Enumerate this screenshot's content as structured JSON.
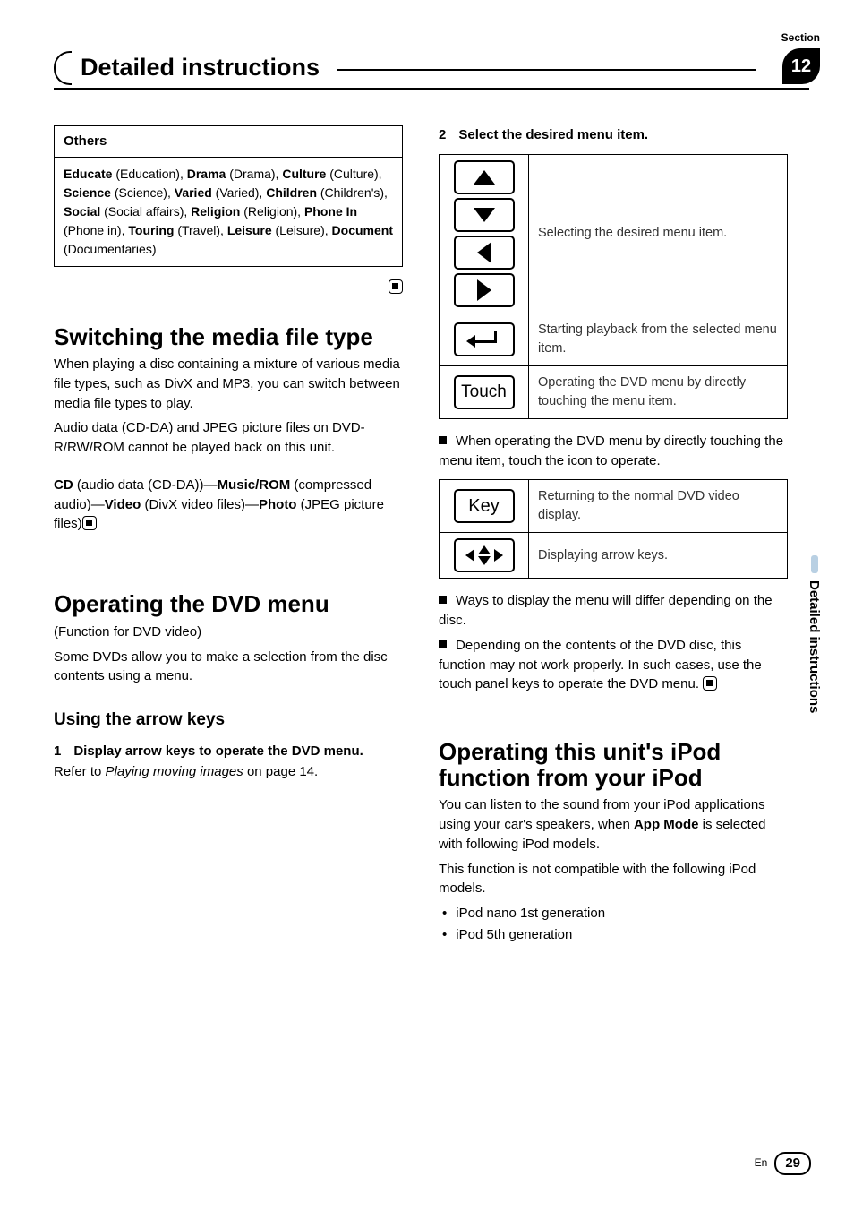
{
  "header": {
    "section_label": "Section",
    "section_number": "12",
    "title": "Detailed instructions"
  },
  "left": {
    "others_box": {
      "header": "Others",
      "body_segments": [
        {
          "b": "Educate",
          "t": " (Education), "
        },
        {
          "b": "Drama",
          "t": " (Drama), "
        },
        {
          "b": "Culture",
          "t": " (Culture), "
        },
        {
          "b": "Science",
          "t": " (Science), "
        },
        {
          "b": "Varied",
          "t": " (Varied), "
        },
        {
          "b": "Children",
          "t": " (Children's), "
        },
        {
          "b": "Social",
          "t": " (Social affairs), "
        },
        {
          "b": "Religion",
          "t": " (Religion), "
        },
        {
          "b": "Phone In",
          "t": " (Phone in), "
        },
        {
          "b": "Touring",
          "t": " (Travel), "
        },
        {
          "b": "Leisure",
          "t": " (Leisure), "
        },
        {
          "b": "Document",
          "t": " (Documentaries)"
        }
      ]
    },
    "switching_heading": "Switching the media file type",
    "switching_p1": "When playing a disc containing a mixture of various media file types, such as DivX and MP3, you can switch between media file types to play.",
    "switching_p2": "Audio data (CD-DA) and JPEG picture files on DVD-R/RW/ROM cannot be played back on this unit.",
    "switching_chain": [
      {
        "b": "CD",
        "t": " (audio data (CD-DA))—"
      },
      {
        "b": "Music/ROM",
        "t": " (compressed audio)—"
      },
      {
        "b": "Video",
        "t": " (DivX video files)—"
      },
      {
        "b": "Photo",
        "t": " (JPEG picture files)"
      }
    ],
    "operating_heading": "Operating the DVD menu",
    "operating_p1": "(Function for DVD video)",
    "operating_p2": "Some DVDs allow you to make a selection from the disc contents using a menu.",
    "arrow_heading": "Using the arrow keys",
    "step1_num": "1",
    "step1_text": "Display arrow keys to operate the DVD menu.",
    "refer_prefix": "Refer to ",
    "refer_em": "Playing moving images",
    "refer_suffix": " on page 14."
  },
  "right": {
    "step2_num": "2",
    "step2_text": "Select the desired menu item.",
    "table1": {
      "arrows_desc": "Selecting the desired menu item.",
      "enter_desc": "Starting playback from the selected menu item.",
      "touch_label": "Touch",
      "touch_desc": "Operating the DVD menu by directly touching the menu item."
    },
    "note1": "When operating the DVD menu by directly touching the menu item, touch the icon to operate.",
    "table2": {
      "key_label": "Key",
      "key_desc": "Returning to the normal DVD video display.",
      "arrows_desc": "Displaying arrow keys."
    },
    "note2": "Ways to display the menu will differ depending on the disc.",
    "note3": "Depending on the contents of the DVD disc, this function may not work properly. In such cases, use the touch panel keys to operate the DVD menu.",
    "ipod_heading": "Operating this unit's iPod function from your iPod",
    "ipod_p1a": "You can listen to the sound from your iPod applications using your car's speakers, when ",
    "ipod_p1b_bold": "App Mode",
    "ipod_p1c": " is selected with following iPod models.",
    "ipod_p2": "This function is not compatible with the following iPod models.",
    "ipod_bullets": [
      "iPod nano 1st generation",
      "iPod 5th generation"
    ]
  },
  "side_text": "Detailed instructions",
  "footer": {
    "lang": "En",
    "page": "29"
  }
}
